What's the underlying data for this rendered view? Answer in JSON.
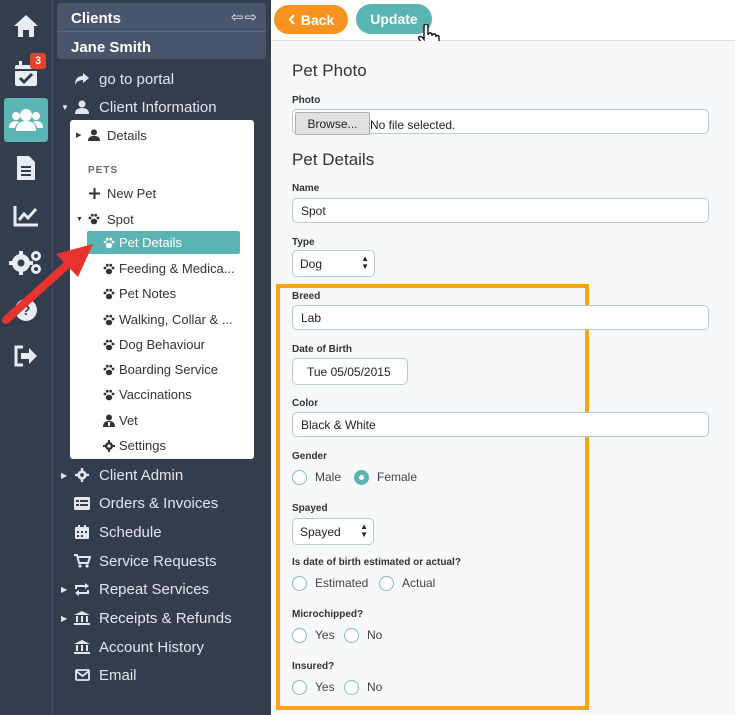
{
  "rail": {
    "calendar_badge": "3",
    "items": [
      "home-icon",
      "calendar-check-icon",
      "clients-icon",
      "document-icon",
      "chart-icon",
      "settings-icon",
      "help-icon",
      "logout-icon"
    ]
  },
  "sidebar": {
    "title": "Clients",
    "nav_arrows": "⇦⇨",
    "client_name": "Jane Smith",
    "portal": "go to portal",
    "client_info": "Client Information",
    "sub": {
      "details": "Details",
      "pets_heading": "PETS",
      "new_pet": "New Pet",
      "spot": "Spot",
      "pet_items": [
        "Pet Details",
        "Feeding & Medica...",
        "Pet Notes",
        "Walking, Collar & ...",
        "Dog Behaviour",
        "Boarding Service",
        "Vaccinations",
        "Vet",
        "Settings"
      ]
    },
    "items": [
      "Client Admin",
      "Orders & Invoices",
      "Schedule",
      "Service Requests",
      "Repeat Services",
      "Receipts & Refunds",
      "Account History",
      "Email"
    ]
  },
  "toolbar": {
    "back": "Back",
    "update": "Update"
  },
  "form": {
    "pet_photo_title": "Pet Photo",
    "photo_label": "Photo",
    "browse": "Browse...",
    "no_file": "No file selected.",
    "pet_details_title": "Pet Details",
    "name_label": "Name",
    "name_value": "Spot",
    "type_label": "Type",
    "type_value": "Dog",
    "breed_label": "Breed",
    "breed_value": "Lab",
    "dob_label": "Date of Birth",
    "dob_value": "Tue 05/05/2015",
    "color_label": "Color",
    "color_value": "Black & White",
    "gender_label": "Gender",
    "gender_male": "Male",
    "gender_female": "Female",
    "gender_selected": "Female",
    "spayed_label": "Spayed",
    "spayed_value": "Spayed",
    "dob_est_label": "Is date of birth estimated or actual?",
    "estimated": "Estimated",
    "actual": "Actual",
    "microchipped_label": "Microchipped?",
    "insured_label": "Insured?",
    "yes": "Yes",
    "no": "No"
  },
  "colors": {
    "sidebar": "#323d4e",
    "accent": "#5bb4b2",
    "back": "#f7931e",
    "highlight": "#f9a21a",
    "arrow": "#e8322d"
  }
}
